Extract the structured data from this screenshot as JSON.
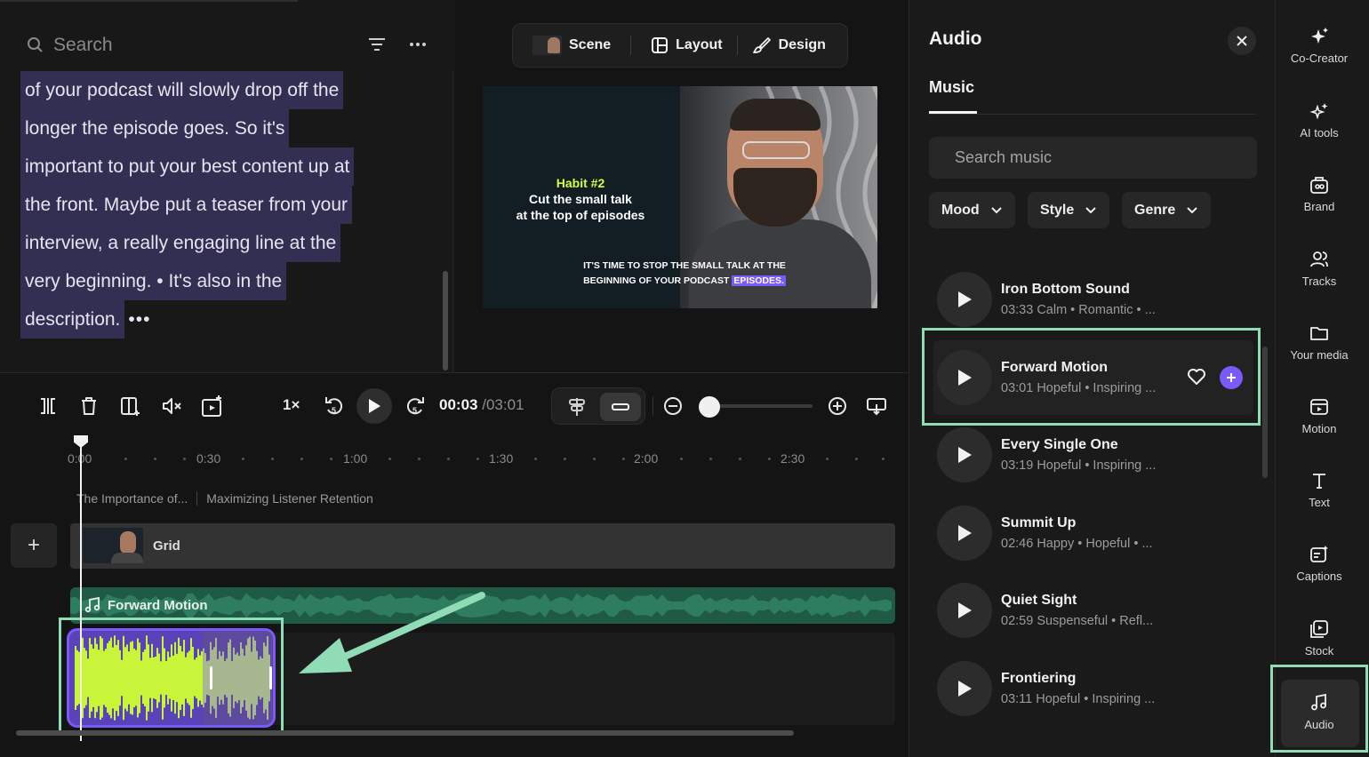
{
  "script_panel": {
    "search_placeholder": "Search",
    "transcript_lines": [
      "of your podcast will slowly drop off the",
      "longer  the episode goes. So it's",
      "important to put your best content up at",
      "the front. Maybe put a teaser from your",
      "interview, a really engaging line at the",
      "very beginning. • It's also in the",
      "description."
    ],
    "more_indicator": "•••"
  },
  "toolbar": {
    "scene_label": "Scene",
    "layout_label": "Layout",
    "design_label": "Design"
  },
  "preview": {
    "habit_title": "Habit #2",
    "habit_line1": "Cut the small talk",
    "habit_line2": "at the top of episodes",
    "caption_line1": "IT'S TIME TO STOP THE SMALL TALK AT THE",
    "caption_line2_a": "BEGINNING OF YOUR PODCAST",
    "caption_line2_b": "EPISODES."
  },
  "timeline_controls": {
    "speed": "1×",
    "current_time": "00:03",
    "total_time": "/03:01",
    "zoom_level_fraction": 0.0
  },
  "ruler": {
    "ticks": [
      "0:00",
      "0:30",
      "1:00",
      "1:30",
      "2:00",
      "2:30"
    ]
  },
  "scenes": {
    "scene_1": "The Importance of...",
    "scene_2": "Maximizing Listener Retention"
  },
  "tracks": {
    "add_label": "+",
    "grid_label": "Grid",
    "music_label": "Forward Motion"
  },
  "audio_panel": {
    "title": "Audio",
    "tab_music": "Music",
    "search_placeholder": "Search music",
    "filters": [
      "Mood",
      "Style",
      "Genre"
    ],
    "songs": [
      {
        "title": "Iron Bottom Sound",
        "meta": "03:33 Calm • Romantic • ..."
      },
      {
        "title": "Forward Motion",
        "meta": "03:01 Hopeful • Inspiring ..."
      },
      {
        "title": "Every Single One",
        "meta": "03:19 Hopeful • Inspiring ..."
      },
      {
        "title": "Summit Up",
        "meta": "02:46 Happy • Hopeful • ..."
      },
      {
        "title": "Quiet Sight",
        "meta": "02:59 Suspenseful • Refl..."
      },
      {
        "title": "Frontiering",
        "meta": "03:11 Hopeful • Inspiring ..."
      }
    ]
  },
  "right_rail": {
    "items": [
      "Co-Creator",
      "AI tools",
      "Brand",
      "Tracks",
      "Your media",
      "Motion",
      "Text",
      "Captions",
      "Stock",
      "Audio"
    ],
    "active": "Audio"
  },
  "colors": {
    "accent_purple": "#7a5af8",
    "highlight_green": "#8fdcb6",
    "music_track": "#1f5a45",
    "clip_wave": "#c8f53a",
    "habit_yellow": "#d6ff3a"
  }
}
